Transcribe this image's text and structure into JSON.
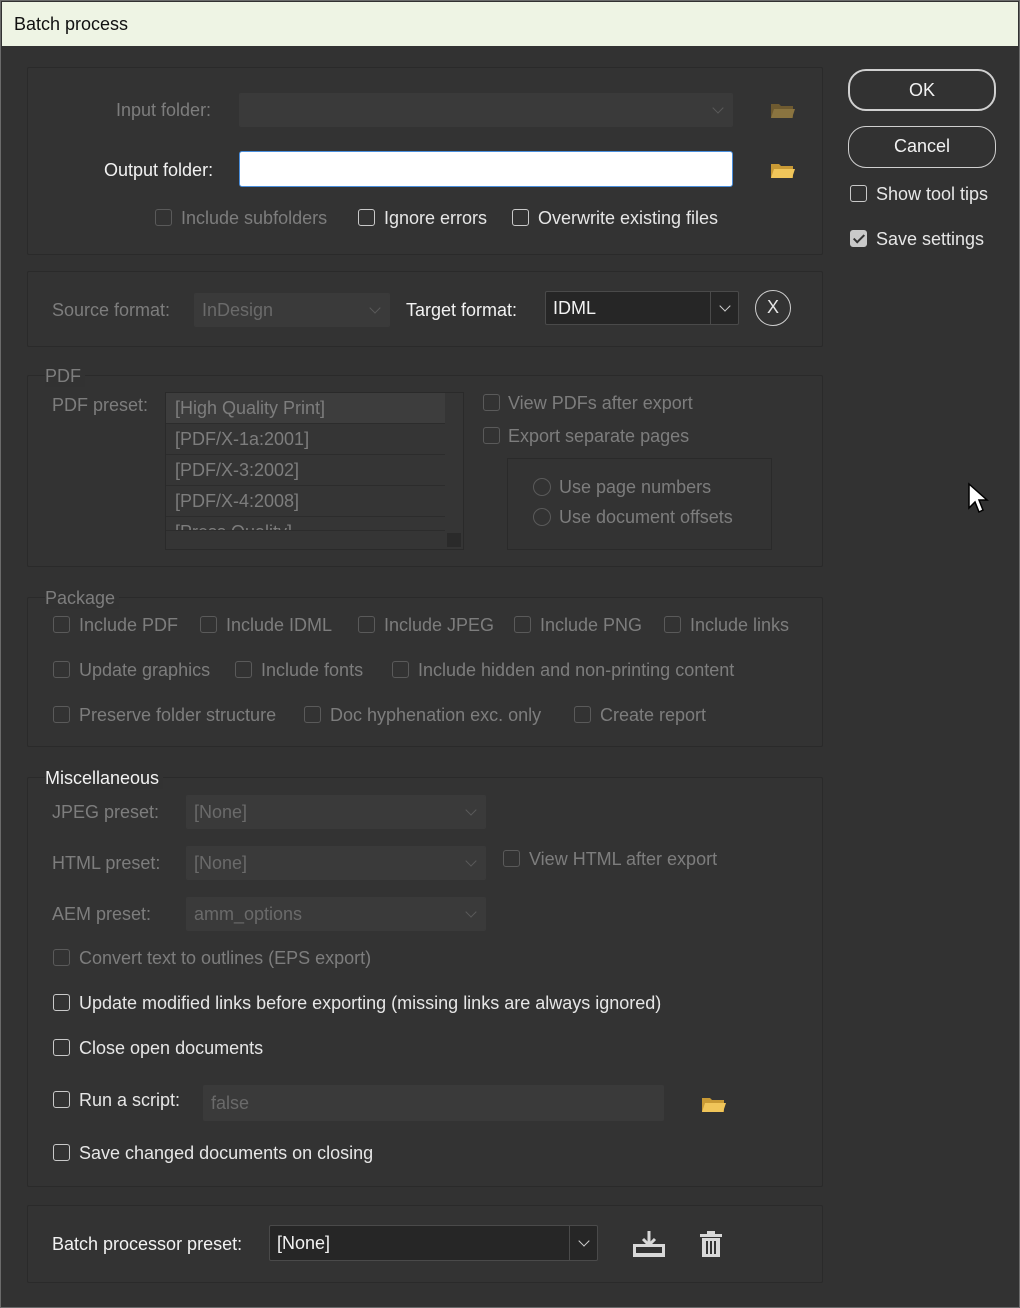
{
  "window": {
    "title": "Batch process"
  },
  "buttons": {
    "ok": "OK",
    "cancel": "Cancel"
  },
  "side": {
    "show_tool_tips": {
      "label": "Show tool tips",
      "checked": false
    },
    "save_settings": {
      "label": "Save settings",
      "checked": true
    }
  },
  "folders": {
    "input_label": "Input folder:",
    "input_value": "",
    "output_label": "Output folder:",
    "output_value": "",
    "include_subfolders": "Include subfolders",
    "ignore_errors": "Ignore errors",
    "overwrite_existing": "Overwrite existing files"
  },
  "formats": {
    "source_label": "Source format:",
    "source_value": "InDesign",
    "target_label": "Target format:",
    "target_value": "IDML",
    "clear_button": "X"
  },
  "pdf": {
    "section_title": "PDF",
    "preset_label": "PDF preset:",
    "presets": [
      "[High Quality Print]",
      "[PDF/X-1a:2001]",
      "[PDF/X-3:2002]",
      "[PDF/X-4:2008]",
      "[Press Quality]"
    ],
    "view_after_export": "View PDFs after export",
    "export_separate_pages": "Export separate pages",
    "use_page_numbers": "Use page numbers",
    "use_document_offsets": "Use document offsets"
  },
  "package": {
    "section_title": "Package",
    "include_pdf": "Include PDF",
    "include_idml": "Include IDML",
    "include_jpeg": "Include JPEG",
    "include_png": "Include PNG",
    "include_links": "Include links",
    "update_graphics": "Update graphics",
    "include_fonts": "Include fonts",
    "include_hidden": "Include hidden and non-printing content",
    "preserve_folder": "Preserve folder structure",
    "doc_hyphenation": "Doc hyphenation exc. only",
    "create_report": "Create report"
  },
  "misc": {
    "section_title": "Miscellaneous",
    "jpeg_label": "JPEG preset:",
    "jpeg_value": "[None]",
    "html_label": "HTML preset:",
    "html_value": "[None]",
    "view_html": "View HTML after export",
    "aem_label": "AEM preset:",
    "aem_value": "amm_options",
    "convert_outlines": "Convert text to outlines (EPS export)",
    "update_links": "Update modified links before exporting (missing links are always ignored)",
    "close_docs": "Close open documents",
    "run_script": "Run a script:",
    "script_value": "false",
    "save_changed": "Save changed documents on closing"
  },
  "preset": {
    "label": "Batch processor preset:",
    "value": "[None]"
  },
  "colors": {
    "dialog_bg": "#323232",
    "titlebar_bg": "#eef4e4",
    "folder_icon": "#e8b84a"
  }
}
